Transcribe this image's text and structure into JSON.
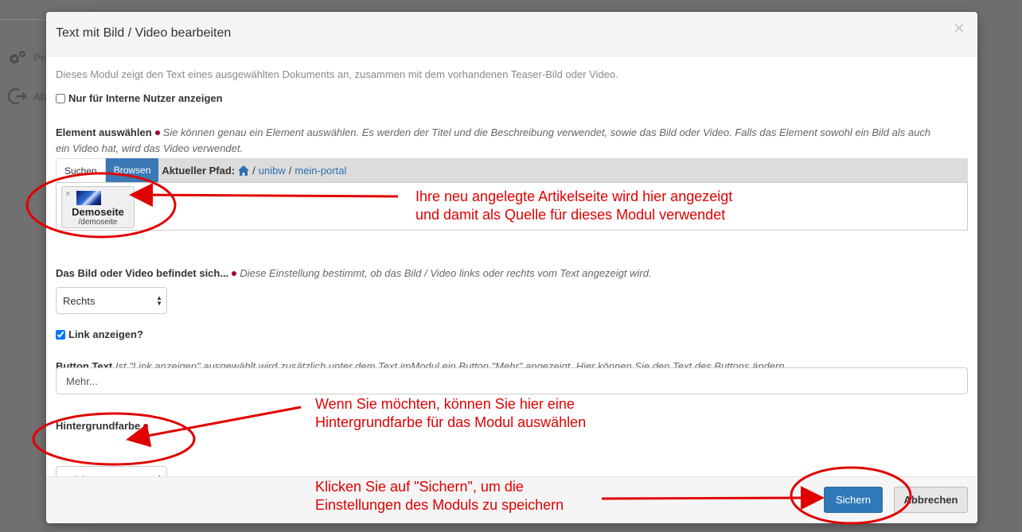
{
  "background": {
    "sidebar_items": [
      {
        "icon": "gears-icon",
        "label": "Po"
      },
      {
        "icon": "logout-icon",
        "label": "Ab"
      }
    ]
  },
  "modal": {
    "title": "Text mit Bild / Video bearbeiten",
    "close_icon": "×",
    "description": "Dieses Modul zeigt den Text eines ausgewählten Dokuments an, zusammen mit dem vorhandenen Teaser-Bild oder Video.",
    "internal_only": {
      "label": "Nur für Interne Nutzer anzeigen",
      "checked": false
    },
    "element_select": {
      "label": "Element auswählen",
      "hint_line1": "Sie können genau ein Element auswählen. Es werden der Titel und die Beschreibung verwendet, sowie das Bild oder Video. Falls das Element sowohl ein Bild als auch",
      "hint_line2": "ein Video hat, wird das Video verwendet.",
      "tabs": [
        "Suchen",
        "Browsen"
      ],
      "active_tab": "Browsen",
      "path_label": "Aktueller Pfad:",
      "path_separator": "/",
      "path_items": [
        "unibw",
        "mein-portal"
      ],
      "selected": {
        "remove": "×",
        "title": "Demoseite",
        "path": "/demoseite"
      }
    },
    "position": {
      "label": "Das Bild oder Video befindet sich...",
      "hint": "Diese Einstellung bestimmt, ob das Bild / Video links oder rechts vom Text angezeigt wird.",
      "value": "Rechts"
    },
    "show_link": {
      "label": "Link anzeigen?",
      "checked": true
    },
    "button_text": {
      "label": "Button Text",
      "hint": "Ist \"Link anzeigen\" ausgewählt wird zusätzlich unter dem Text imModul ein Button \"Mehr\" angezeigt. Hier können Sie den Text des Buttons ändern.",
      "value": "Mehr..."
    },
    "background_color": {
      "label": "Hintergrundfarbe",
      "value": "Leichtgrau"
    },
    "footer": {
      "save_label": "Sichern",
      "cancel_label": "Abbrechen"
    }
  },
  "annotations": {
    "note1": {
      "line1": "Ihre neu angelegte Artikelseite wird hier angezeigt",
      "line2": "und damit als Quelle für dieses Modul verwendet"
    },
    "note2": {
      "line1": "Wenn Sie möchten, können Sie hier eine",
      "line2": "Hintergrundfarbe für das Modul auswählen"
    },
    "note3": {
      "line1": "Klicken Sie auf \"Sichern\", um die",
      "line2": "Einstellungen des Moduls zu speichern"
    },
    "color": "#e00000"
  },
  "colors": {
    "primary": "#2f79b9",
    "required": "#a0003c",
    "link": "#2d6fb0"
  }
}
